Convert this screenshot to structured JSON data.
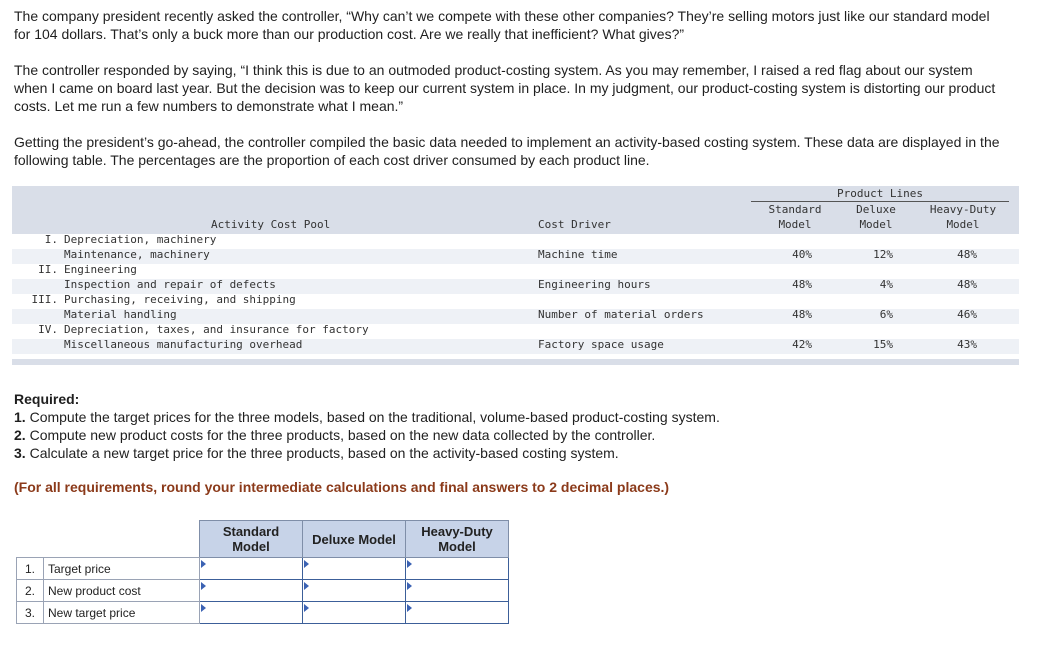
{
  "intro": {
    "p1": "The company president recently asked the controller, “Why can’t we compete with these other companies? They’re selling motors just like our standard model for 104 dollars. That’s only a buck more than our production cost. Are we really that inefficient? What gives?”",
    "p2": "The controller responded by saying, “I think this is due to an outmoded product-costing system. As you may remember, I raised a red flag about our system when I came on board last year. But the decision was to keep our current system in place. In my judgment, our product-costing system is distorting our product costs. Let me run a few numbers to demonstrate what I mean.”",
    "p3": "Getting the president’s go-ahead, the controller compiled the basic data needed to implement an activity-based costing system. These data are displayed in the following table. The percentages are the proportion of each cost driver consumed by each product line."
  },
  "data_table": {
    "product_lines_label": "Product Lines",
    "col_pool": "Activity Cost Pool",
    "col_driver": "Cost Driver",
    "col_standard": [
      "Standard",
      "Model"
    ],
    "col_deluxe": [
      "Deluxe",
      "Model"
    ],
    "col_heavy": [
      "Heavy-Duty",
      "Model"
    ],
    "pools": [
      {
        "num": "I.",
        "line1": "Depreciation, machinery",
        "line2": "Maintenance, machinery",
        "driver": "Machine time",
        "standard": "40%",
        "deluxe": "12%",
        "heavy": "48%"
      },
      {
        "num": "II.",
        "line1": "Engineering",
        "line2": "Inspection and repair of defects",
        "driver": "Engineering hours",
        "standard": "48%",
        "deluxe": "4%",
        "heavy": "48%"
      },
      {
        "num": "III.",
        "line1": "Purchasing, receiving, and shipping",
        "line2": "Material handling",
        "driver": "Number of material orders",
        "standard": "48%",
        "deluxe": "6%",
        "heavy": "46%"
      },
      {
        "num": "IV.",
        "line1": "Depreciation, taxes, and insurance for factory",
        "line2": "Miscellaneous manufacturing overhead",
        "driver": "Factory space usage",
        "standard": "42%",
        "deluxe": "15%",
        "heavy": "43%"
      }
    ]
  },
  "required": {
    "heading": "Required:",
    "items": [
      {
        "num": "1.",
        "text": "Compute the target prices for the three models, based on the traditional, volume-based product-costing system."
      },
      {
        "num": "2.",
        "text": "Compute new product costs for the three products, based on the new data collected by the controller."
      },
      {
        "num": "3.",
        "text": "Calculate a new target price for the three products, based on the activity-based costing system."
      }
    ],
    "note": "(For all requirements, round your intermediate calculations and final answers to 2 decimal places.)"
  },
  "answer_table": {
    "headers": [
      [
        "Standard",
        "Model"
      ],
      [
        "Deluxe Model"
      ],
      [
        "Heavy-Duty",
        "Model"
      ]
    ],
    "rows": [
      {
        "num": "1.",
        "label": "Target price"
      },
      {
        "num": "2.",
        "label": "New product cost"
      },
      {
        "num": "3.",
        "label": "New target price"
      }
    ]
  }
}
